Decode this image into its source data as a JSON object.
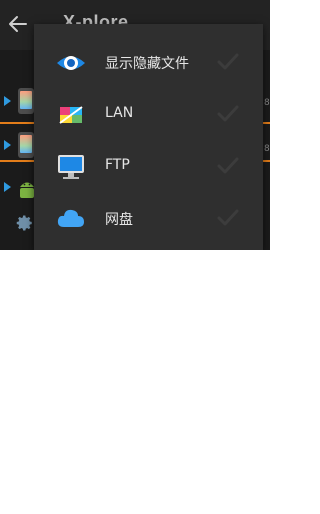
{
  "app_bar": {
    "title": "X-plore"
  },
  "background_rows": [
    {
      "icon": "phone-icon",
      "right_text": "8"
    },
    {
      "icon": "phone-icon",
      "right_text": "8"
    },
    {
      "icon": "android-icon",
      "right_text": ""
    }
  ],
  "menu": {
    "items": [
      {
        "label": "显示隐藏文件",
        "icon": "eye-icon",
        "checked": false
      },
      {
        "label": "LAN",
        "icon": "lan-icon",
        "checked": false
      },
      {
        "label": "FTP",
        "icon": "ftp-icon",
        "checked": false
      },
      {
        "label": "网盘",
        "icon": "cloud-icon",
        "checked": false
      }
    ]
  },
  "colors": {
    "accent_orange": "#e37d1a",
    "accent_blue": "#2f9ae0",
    "menu_background": "#2f2f2f",
    "menu_text": "#e6e6e6"
  }
}
